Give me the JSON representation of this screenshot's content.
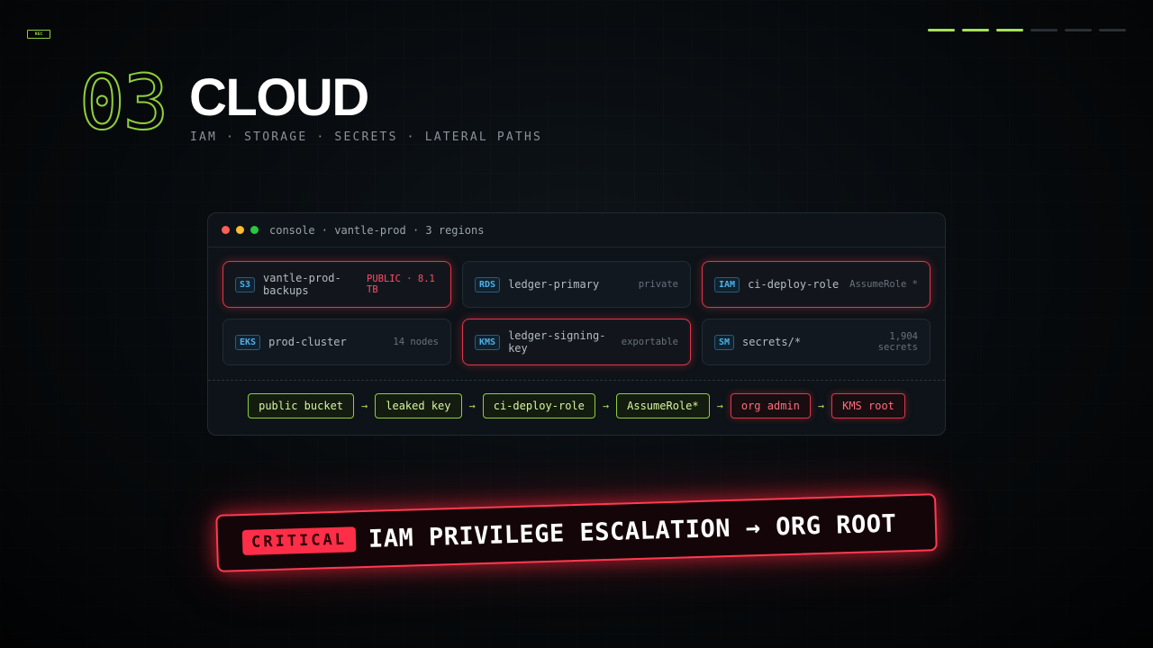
{
  "header": {
    "rec_label": "REC",
    "progress": {
      "total": 6,
      "completed": 3
    },
    "section_number": "03",
    "section_title": "CLOUD",
    "section_subtitle": "IAM · STORAGE · SECRETS · LATERAL PATHS"
  },
  "console": {
    "title": "console · vantle-prod · 3 regions",
    "window_dots": [
      "close",
      "minimize",
      "maximize"
    ],
    "resources": [
      {
        "service": "S3",
        "name": "vantle-prod-backups",
        "meta": "PUBLIC · 8.1 TB",
        "severity": "critical"
      },
      {
        "service": "RDS",
        "name": "ledger-primary",
        "meta": "private",
        "severity": "normal"
      },
      {
        "service": "IAM",
        "name": "ci-deploy-role",
        "meta": "AssumeRole *",
        "severity": "critical"
      },
      {
        "service": "EKS",
        "name": "prod-cluster",
        "meta": "14 nodes",
        "severity": "normal"
      },
      {
        "service": "KMS",
        "name": "ledger-signing-key",
        "meta": "exportable",
        "severity": "critical"
      },
      {
        "service": "SM",
        "name": "secrets/*",
        "meta": "1,904 secrets",
        "severity": "normal"
      }
    ],
    "attack_path": {
      "arrow": "→",
      "steps": [
        {
          "label": "public bucket",
          "severity": "warn"
        },
        {
          "label": "leaked key",
          "severity": "warn"
        },
        {
          "label": "ci-deploy-role",
          "severity": "warn"
        },
        {
          "label": "AssumeRole*",
          "severity": "warn"
        },
        {
          "label": "org admin",
          "severity": "critical"
        },
        {
          "label": "KMS root",
          "severity": "critical"
        }
      ]
    }
  },
  "banner": {
    "badge": "CRITICAL",
    "text": "IAM PRIVILEGE ESCALATION → ORG ROOT"
  },
  "colors": {
    "accent": "#a6e15a",
    "critical": "#ff3a52",
    "service_tag": "#4fb0e6",
    "background": "#0a0e12"
  }
}
